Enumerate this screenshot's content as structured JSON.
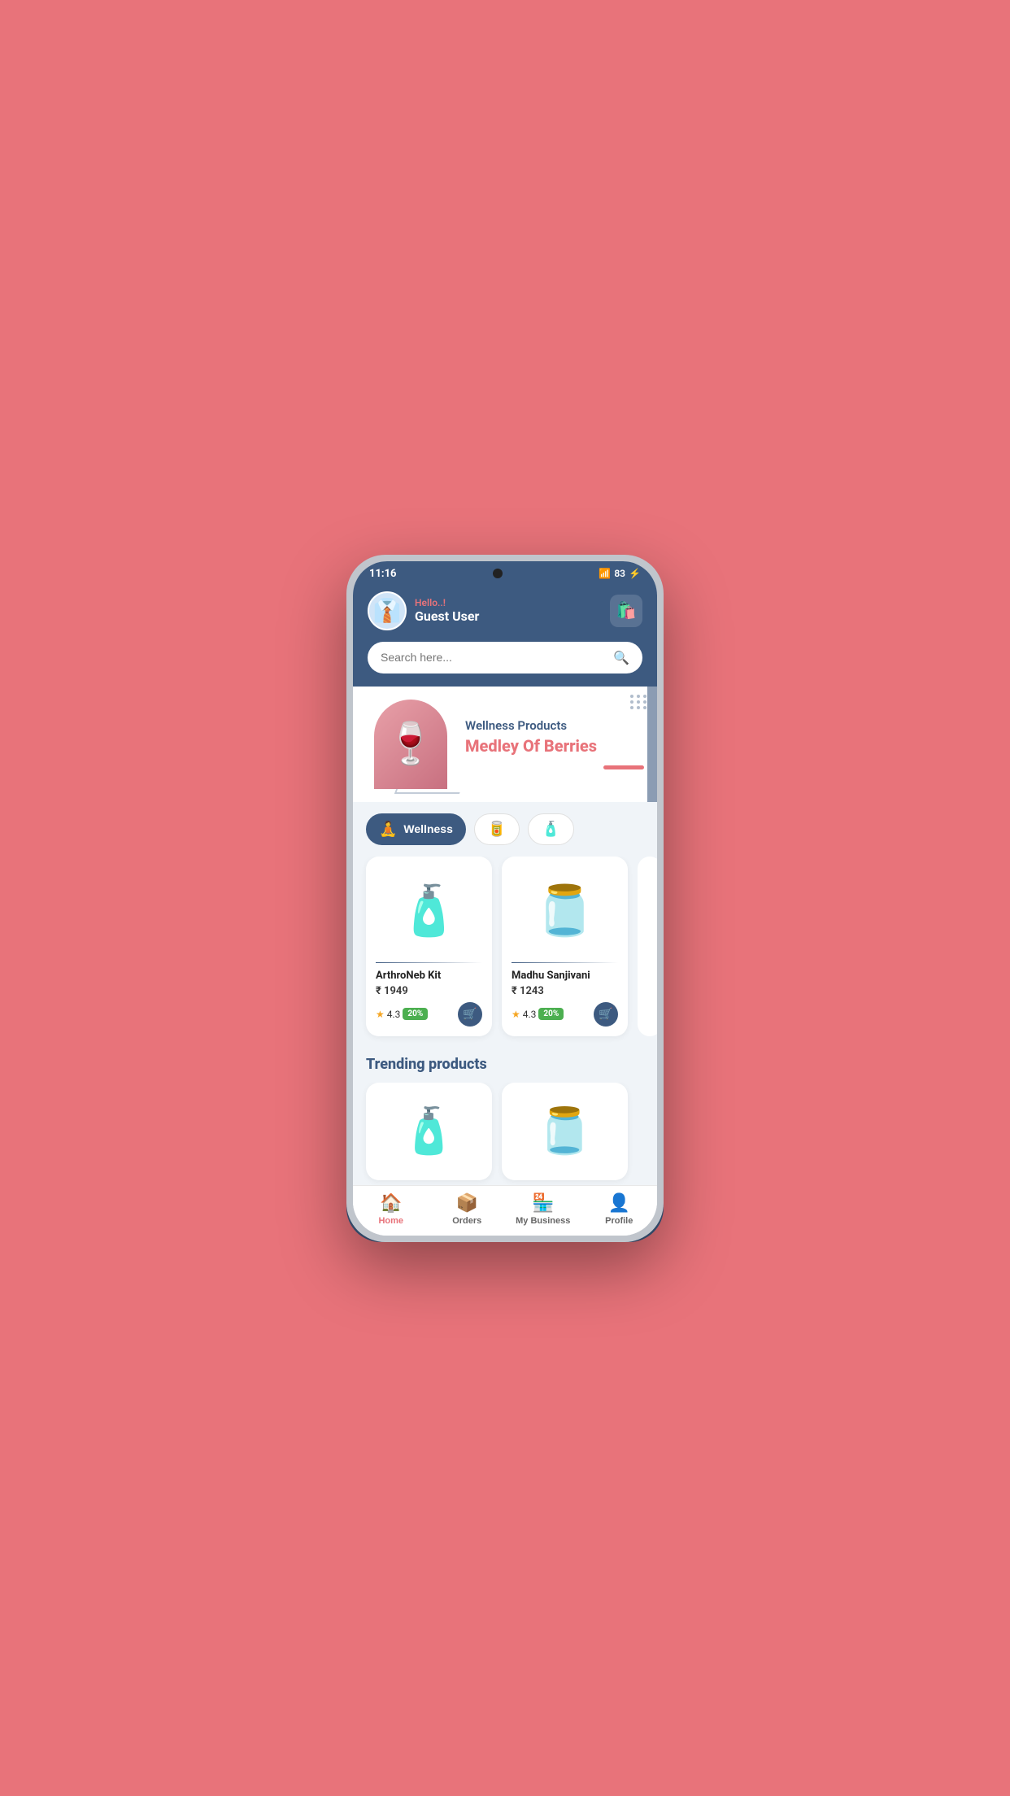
{
  "statusBar": {
    "time": "11:16",
    "battery": "83"
  },
  "header": {
    "greeting": "Hello..!",
    "userName": "Guest User",
    "cartLabel": "cart"
  },
  "search": {
    "placeholder": "Search here..."
  },
  "banner": {
    "subtitle": "Wellness Products",
    "title": "Medley Of Berries"
  },
  "categories": [
    {
      "id": "wellness",
      "label": "Wellness",
      "icon": "🧘",
      "active": true
    },
    {
      "id": "food",
      "label": "Food",
      "icon": "🥫",
      "active": false
    },
    {
      "id": "cleaning",
      "label": "Cleaning",
      "icon": "🧴",
      "active": false
    }
  ],
  "products": [
    {
      "name": "ArthroNeb Kit",
      "price": "₹ 1949",
      "rating": "4.3",
      "discount": "20%",
      "img": "💊"
    },
    {
      "name": "Madhu Sanjivani",
      "price": "₹ 1243",
      "rating": "4.3",
      "discount": "20%",
      "img": "🫙"
    }
  ],
  "trendingTitle": "Trending products",
  "trendingProducts": [
    {
      "img": "💊"
    },
    {
      "img": "🫙"
    }
  ],
  "bottomNav": [
    {
      "id": "home",
      "label": "Home",
      "icon": "🏠",
      "active": true
    },
    {
      "id": "orders",
      "label": "Orders",
      "icon": "📦",
      "active": false
    },
    {
      "id": "business",
      "label": "My Business",
      "icon": "🏪",
      "active": false
    },
    {
      "id": "profile",
      "label": "Profile",
      "icon": "👤",
      "active": false
    }
  ]
}
